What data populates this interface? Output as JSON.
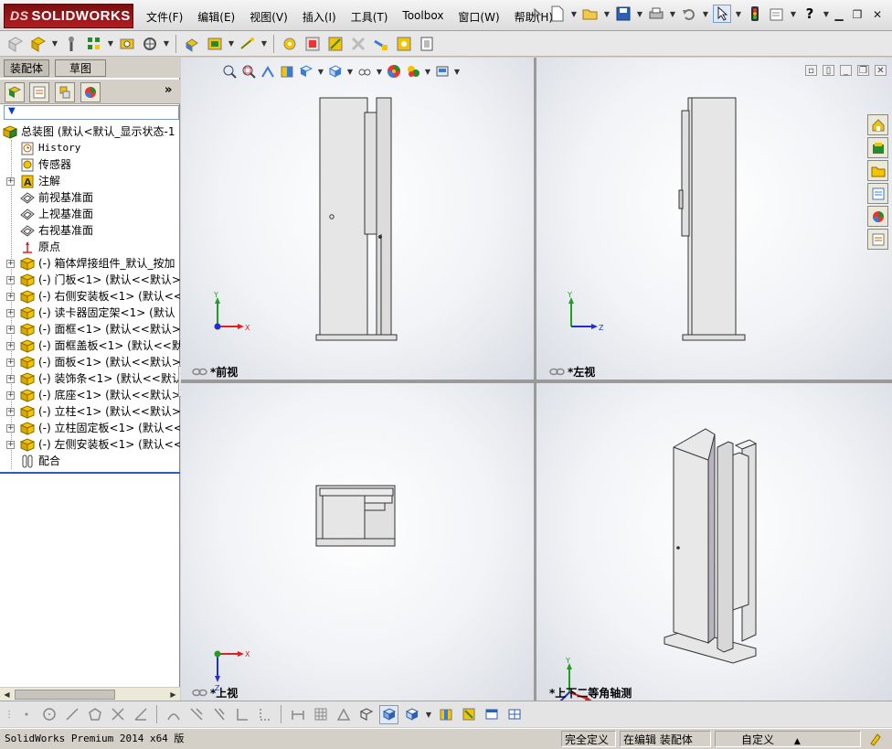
{
  "app": {
    "logo_text": "SOLIDWORKS",
    "logo_prefix": "DS"
  },
  "menu": [
    "文件(F)",
    "编辑(E)",
    "视图(V)",
    "插入(I)",
    "工具(T)",
    "Toolbox",
    "窗口(W)",
    "帮助(H)"
  ],
  "left_tabs": {
    "assembly": "装配体",
    "sketch": "草图"
  },
  "tree": {
    "root": "总装图  (默认<默认_显示状态-1",
    "items": [
      {
        "label": "History",
        "icon": "history-icon",
        "expandable": false,
        "mono": true
      },
      {
        "label": "传感器",
        "icon": "sensor-icon",
        "expandable": false
      },
      {
        "label": "注解",
        "icon": "annotation-icon",
        "expandable": true
      },
      {
        "label": "前视基准面",
        "icon": "plane-icon",
        "expandable": false
      },
      {
        "label": "上视基准面",
        "icon": "plane-icon",
        "expandable": false
      },
      {
        "label": "右视基准面",
        "icon": "plane-icon",
        "expandable": false
      },
      {
        "label": "原点",
        "icon": "origin-icon",
        "expandable": false
      },
      {
        "label": "(-) 箱体焊接组件_默认_按加",
        "icon": "part-icon",
        "expandable": true
      },
      {
        "label": "(-) 门板<1> (默认<<默认>_显",
        "icon": "part-icon",
        "expandable": true
      },
      {
        "label": "(-) 右侧安装板<1> (默认<<默",
        "icon": "part-icon",
        "expandable": true
      },
      {
        "label": "(-) 读卡器固定架<1> (默认",
        "icon": "part-icon",
        "expandable": true
      },
      {
        "label": "(-) 面框<1> (默认<<默认>_显",
        "icon": "part-icon",
        "expandable": true
      },
      {
        "label": "(-) 面框盖板<1> (默认<<默认",
        "icon": "part-icon",
        "expandable": true
      },
      {
        "label": "(-) 面板<1> (默认<<默认>_显",
        "icon": "part-icon",
        "expandable": true
      },
      {
        "label": "(-) 装饰条<1> (默认<<默认>",
        "icon": "part-icon",
        "expandable": true
      },
      {
        "label": "(-) 底座<1> (默认<<默认>_显",
        "icon": "part-icon",
        "expandable": true
      },
      {
        "label": "(-) 立柱<1> (默认<<默认>_显",
        "icon": "part-icon",
        "expandable": true
      },
      {
        "label": "(-) 立柱固定板<1> (默认<<默",
        "icon": "part-icon",
        "expandable": true
      },
      {
        "label": "(-) 左侧安装板<1> (默认<<默",
        "icon": "part-icon",
        "expandable": true
      },
      {
        "label": "配合",
        "icon": "mate-icon",
        "expandable": false
      }
    ]
  },
  "viewports": {
    "front": "*前视",
    "left": "*左视",
    "top": "*上视",
    "iso": "*上下二等角轴测"
  },
  "axes": {
    "x": "X",
    "y": "Y",
    "z": "Z"
  },
  "status": {
    "version": "SolidWorks Premium 2014 x64 版",
    "defined": "完全定义",
    "editing": "在编辑 装配体",
    "custom": "自定义"
  },
  "colors": {
    "logo_red": "#a8181c",
    "part_yellow": "#f4c400",
    "axis_x": "#e02020",
    "axis_y": "#20a020",
    "axis_z": "#2030d0"
  }
}
